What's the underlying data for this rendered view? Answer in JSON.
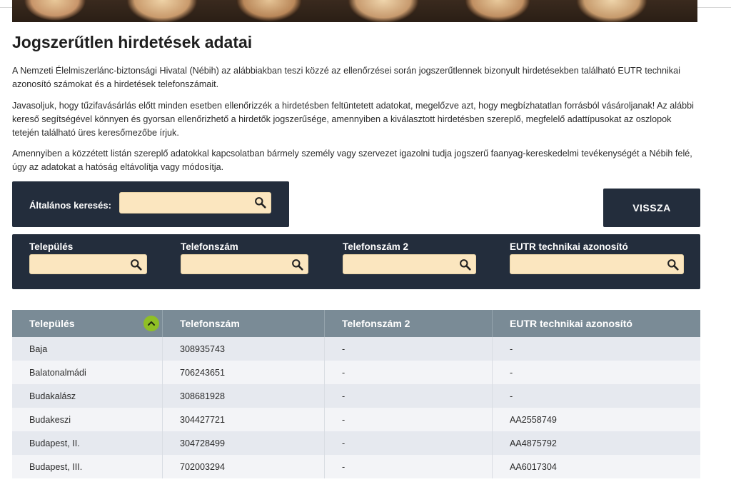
{
  "page": {
    "title": "Jogszerűtlen hirdetések adatai",
    "paragraphs": [
      "A Nemzeti Élelmiszerlánc-biztonsági Hivatal (Nébih) az alábbiakban teszi közzé az ellenőrzései során jogszerűtlennek bizonyult hirdetésekben található EUTR technikai azonosító számokat és a hirdetések telefonszámait.",
      "Javasoljuk, hogy tűzifavásárlás előtt minden esetben ellenőrizzék a hirdetésben feltüntetett adatokat, megelőzve azt, hogy megbízhatatlan forrásból vásároljanak! Az alábbi kereső segítségével könnyen és gyorsan ellenőrizhető a hirdetők jogszerűsége, amennyiben a kiválasztott hirdetésben szereplő, megfelelő adattípusokat az oszlopok tetején található üres keresőmezőbe írjuk.",
      "Amennyiben a közzétett listán szereplő adatokkal kapcsolatban bármely személy vagy szervezet igazolni tudja jogszerű faanyag-kereskedelmi tevékenységét a Nébih felé, úgy az adatokat a hatóság eltávolítja vagy módosítja."
    ]
  },
  "general_search": {
    "label": "Általános keresés:",
    "value": ""
  },
  "back_button": {
    "label": "VISSZA"
  },
  "filters": [
    {
      "label": "Település",
      "value": ""
    },
    {
      "label": "Telefonszám",
      "value": ""
    },
    {
      "label": "Telefonszám 2",
      "value": ""
    },
    {
      "label": "EUTR technikai azonosító",
      "value": ""
    }
  ],
  "table": {
    "columns": [
      "Település",
      "Telefonszám",
      "Telefonszám 2",
      "EUTR technikai azonosító"
    ],
    "sorted_column": "Település",
    "rows": [
      [
        "Baja",
        "308935743",
        "-",
        "-"
      ],
      [
        "Balatonalmádi",
        "706243651",
        "-",
        "-"
      ],
      [
        "Budakalász",
        "308681928",
        "-",
        "-"
      ],
      [
        "Budakeszi",
        "304427721",
        "-",
        "AA2558749"
      ],
      [
        "Budapest, II.",
        "304728499",
        "-",
        "AA4875792"
      ],
      [
        "Budapest, III.",
        "702003294",
        "-",
        "AA6017304"
      ]
    ]
  },
  "colors": {
    "panel": "#232d3c",
    "input": "#fbe6bf",
    "table_header": "#7a8b96",
    "sort_accent": "#8fbf25"
  }
}
